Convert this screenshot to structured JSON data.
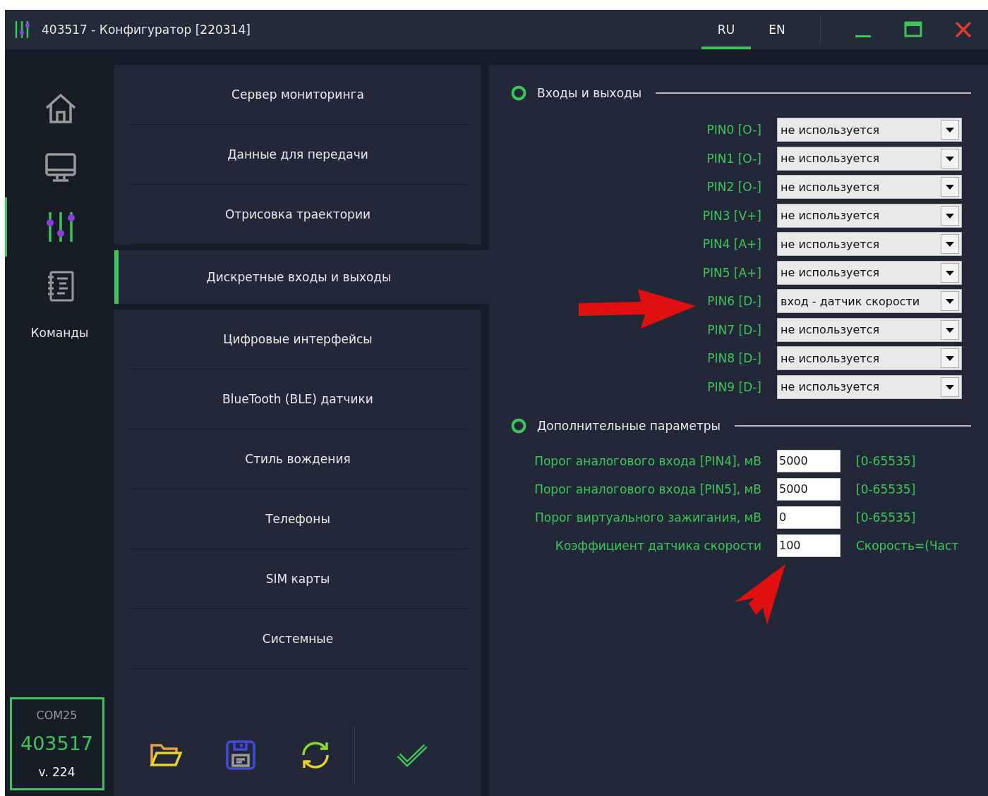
{
  "window": {
    "title": "403517 - Конфигуратор [220314]"
  },
  "languages": [
    {
      "label": "RU",
      "selected": true
    },
    {
      "label": "EN",
      "selected": false
    }
  ],
  "nav": [
    {
      "kind": "home",
      "selected": false
    },
    {
      "kind": "monitor",
      "selected": false
    },
    {
      "kind": "sliders",
      "selected": true
    },
    {
      "kind": "notebook",
      "selected": false,
      "label": "Команды"
    }
  ],
  "device": {
    "port": "COM25",
    "id": "403517",
    "version": "v. 224"
  },
  "menu": [
    {
      "label": "Сервер мониторинга",
      "selected": false
    },
    {
      "label": "Данные для передачи",
      "selected": false
    },
    {
      "label": "Отрисовка траектории",
      "selected": false
    },
    {
      "label": "Дискретные входы и выходы",
      "selected": true
    },
    {
      "label": "Цифровые интерфейсы",
      "selected": false
    },
    {
      "label": "BlueTooth (BLE) датчики",
      "selected": false
    },
    {
      "label": "Стиль вождения",
      "selected": false
    },
    {
      "label": "Телефоны",
      "selected": false
    },
    {
      "label": "SIM карты",
      "selected": false
    },
    {
      "label": "Системные",
      "selected": false
    }
  ],
  "toolbar": [
    {
      "kind": "open"
    },
    {
      "kind": "save"
    },
    {
      "kind": "refresh"
    },
    {
      "kind": "apply"
    }
  ],
  "io_section": {
    "title": "Входы и выходы",
    "pins": [
      {
        "label": "PIN0 [O-]",
        "value": "не используется"
      },
      {
        "label": "PIN1 [O-]",
        "value": "не используется"
      },
      {
        "label": "PIN2 [O-]",
        "value": "не используется"
      },
      {
        "label": "PIN3 [V+]",
        "value": "не используется"
      },
      {
        "label": "PIN4 [A+]",
        "value": "не используется"
      },
      {
        "label": "PIN5 [A+]",
        "value": "не используется"
      },
      {
        "label": "PIN6 [D-]",
        "value": "вход - датчик скорости"
      },
      {
        "label": "PIN7 [D-]",
        "value": "не используется"
      },
      {
        "label": "PIN8 [D-]",
        "value": "не используется"
      },
      {
        "label": "PIN9 [D-]",
        "value": "не используется"
      }
    ]
  },
  "extra_section": {
    "title": "Дополнительные параметры",
    "params": [
      {
        "label": "Порог аналогового входа [PIN4], мВ",
        "value": "5000",
        "hint": "[0-65535]"
      },
      {
        "label": "Порог аналогового входа [PIN5], мВ",
        "value": "5000",
        "hint": "[0-65535]"
      },
      {
        "label": "Порог виртуального зажигания, мВ",
        "value": "0",
        "hint": "[0-65535]"
      },
      {
        "label": "Коэффициент датчика скорости",
        "value": "100",
        "hint": "Скорость=(Част"
      }
    ]
  }
}
